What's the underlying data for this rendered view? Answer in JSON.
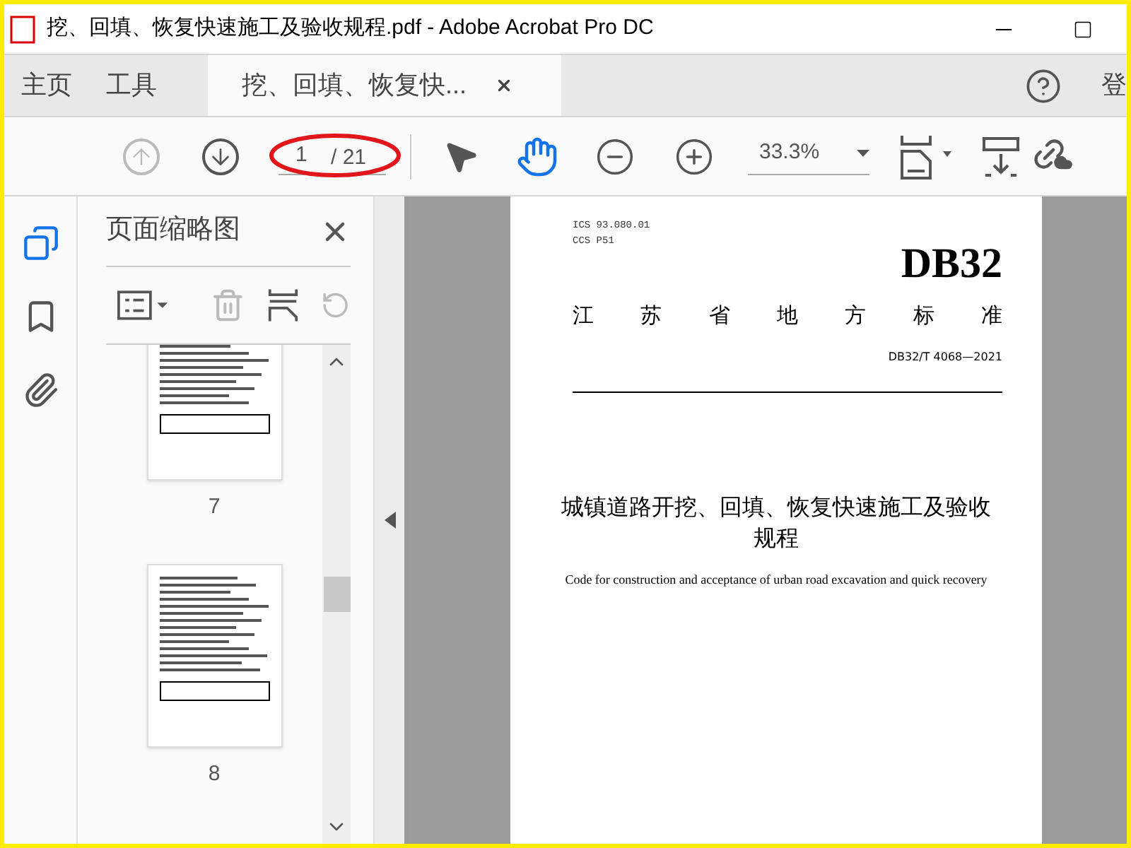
{
  "window": {
    "title": "挖、回填、恢复快速施工及验收规程.pdf - Adobe Acrobat Pro DC"
  },
  "tabs": [
    {
      "label": "主页",
      "selected": false
    },
    {
      "label": "工具",
      "selected": false
    },
    {
      "label": "挖、回填、恢复快...",
      "selected": true,
      "kind": "document"
    }
  ],
  "login_label": "登",
  "toolbar": {
    "page_value": "1",
    "page_total": "/ 21",
    "zoom": "33.3%",
    "hand_tool_selected": true
  },
  "panel": {
    "title": "页面缩略图",
    "thumbnails": [
      {
        "label": "7",
        "selected": false
      },
      {
        "label": "8",
        "selected": false
      }
    ]
  },
  "document": {
    "ics": "ICS 93.080.01",
    "ccs": "CCS P51",
    "code": "DB32",
    "standard_type": "江苏省地方标准",
    "number": "DB32/T 4068—2021",
    "title": "城镇道路开挖、回填、恢复快速施工及验收规程",
    "subtitle": "Code for construction and acceptance of urban road excavation and quick recovery"
  }
}
